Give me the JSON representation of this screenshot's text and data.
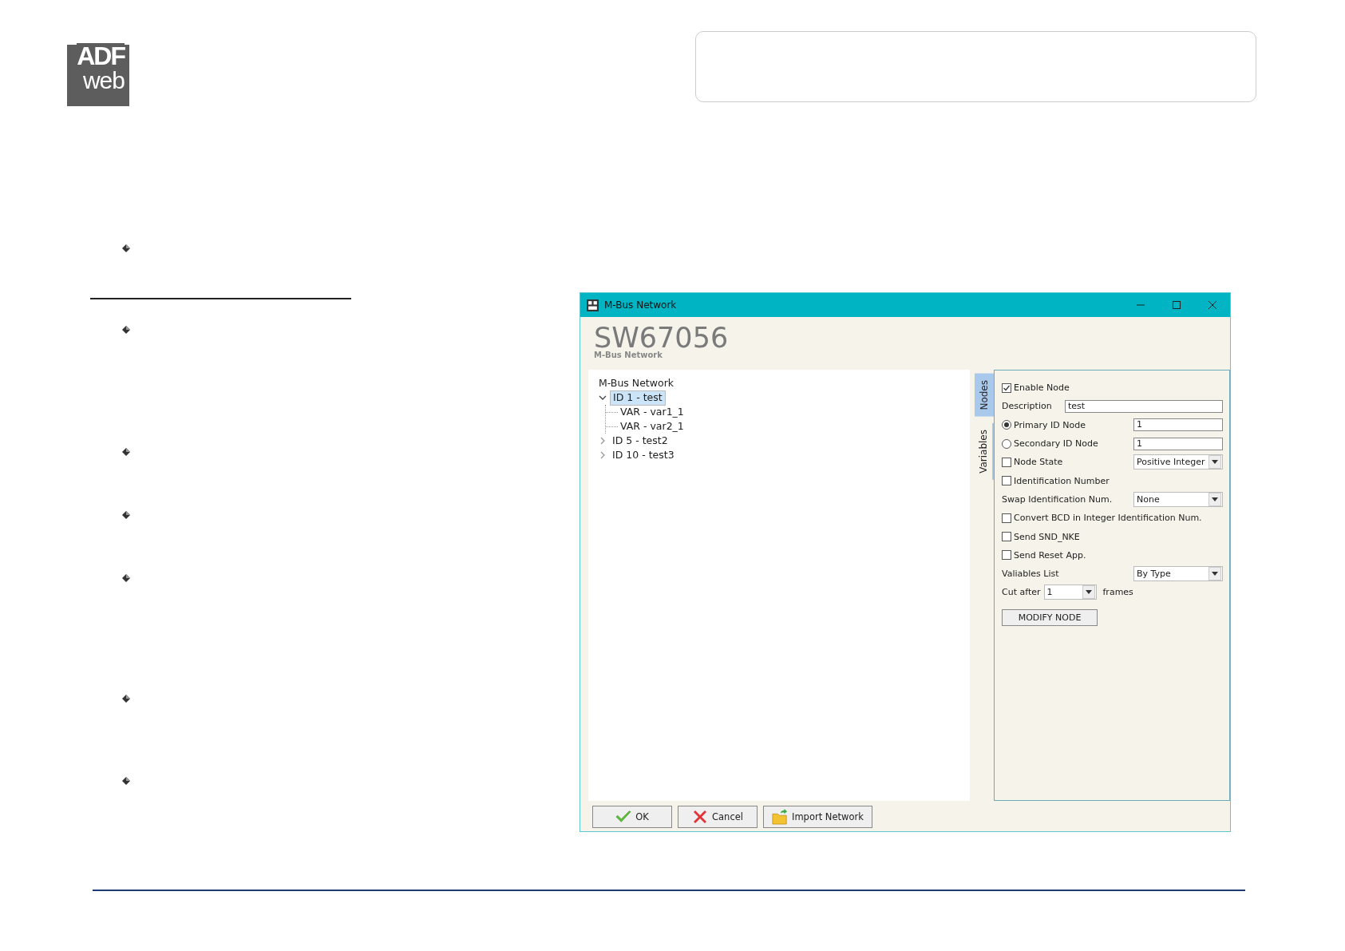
{
  "logo": {
    "line1": "ADF",
    "line2": "web"
  },
  "window": {
    "title": "M-Bus Network",
    "app_title": "SW67056",
    "app_subtitle": "M-Bus Network"
  },
  "tree": {
    "root": "M-Bus Network",
    "nodes": [
      {
        "label": "ID 1 - test",
        "expanded": true,
        "selected": true,
        "children": [
          {
            "label": "VAR - var1_1"
          },
          {
            "label": "VAR - var2_1"
          }
        ]
      },
      {
        "label": "ID 5 - test2",
        "expanded": false,
        "selected": false
      },
      {
        "label": "ID 10 - test3",
        "expanded": false,
        "selected": false
      }
    ]
  },
  "side_tabs": [
    {
      "label": "Nodes",
      "selected": true
    },
    {
      "label": "Variables",
      "selected": false
    }
  ],
  "form": [
    {
      "kind": "checkbox",
      "label": "Enable Node",
      "checked": true
    },
    {
      "kind": "text",
      "label": "Description",
      "value": "test"
    },
    {
      "kind": "radio_text",
      "label": "Primary ID Node",
      "selected": true,
      "value": "1"
    },
    {
      "kind": "radio_text",
      "label": "Secondary ID Node",
      "selected": false,
      "value": "1"
    },
    {
      "kind": "checkbox_select",
      "label": "Node State",
      "checked": false,
      "value": "Positive Integer"
    },
    {
      "kind": "checkbox",
      "label": "Identification Number",
      "checked": false
    },
    {
      "kind": "select",
      "label": "Swap Identification Num.",
      "value": "None"
    },
    {
      "kind": "checkbox",
      "label": "Convert BCD in Integer Identification Num.",
      "checked": false
    },
    {
      "kind": "checkbox",
      "label": "Send SND_NKE",
      "checked": false
    },
    {
      "kind": "checkbox",
      "label": "Send Reset App.",
      "checked": false
    },
    {
      "kind": "select",
      "label": "Valiables List",
      "value": "By Type"
    },
    {
      "kind": "inline_select",
      "label": "Cut after",
      "value": "1",
      "suffix": "frames"
    },
    {
      "kind": "button",
      "label": "MODIFY NODE"
    }
  ],
  "buttons": [
    {
      "kind": "ok",
      "label": "OK"
    },
    {
      "kind": "cancel",
      "label": "Cancel"
    },
    {
      "kind": "import",
      "label": "Import Network"
    }
  ]
}
